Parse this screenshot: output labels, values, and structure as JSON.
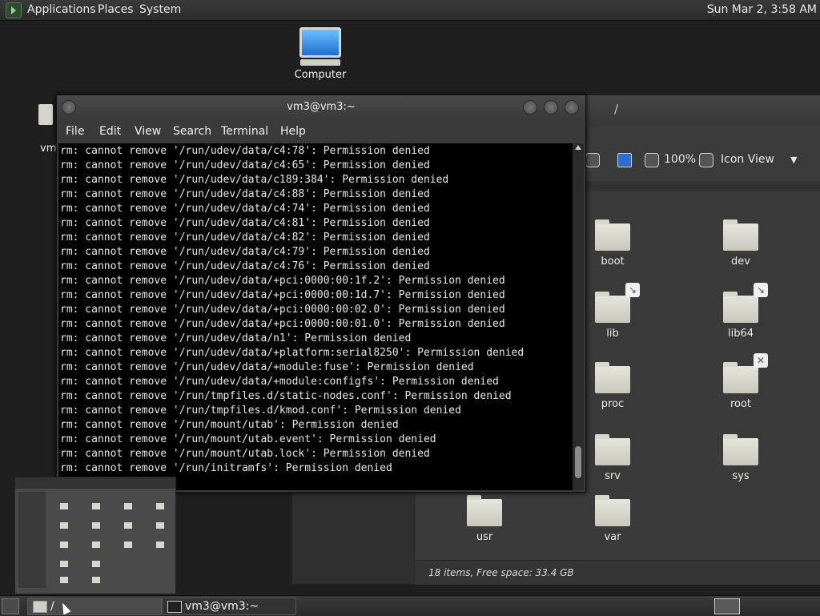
{
  "top_panel": {
    "menus": [
      "Applications",
      "Places",
      "System"
    ],
    "clock": "Sun Mar 2,  3:58 AM"
  },
  "desktop": {
    "icons": [
      {
        "label": "Computer",
        "icon": "computer-icon"
      },
      {
        "label": "vm",
        "icon": "home-folder-icon"
      }
    ]
  },
  "file_manager": {
    "title": "/",
    "zoom": "100%",
    "view_mode": "Icon View",
    "folders": [
      "boot",
      "dev",
      "lib",
      "lib64",
      "proc",
      "root",
      "srv",
      "sys",
      "usr",
      "var"
    ],
    "status": "18 items, Free space: 33.4 GB"
  },
  "terminal": {
    "title": "vm3@vm3:~",
    "menu": [
      "File",
      "Edit",
      "View",
      "Search",
      "Terminal",
      "Help"
    ],
    "lines": [
      "rm: cannot remove '/run/udev/data/c4:78': Permission denied",
      "rm: cannot remove '/run/udev/data/c4:65': Permission denied",
      "rm: cannot remove '/run/udev/data/c189:384': Permission denied",
      "rm: cannot remove '/run/udev/data/c4:88': Permission denied",
      "rm: cannot remove '/run/udev/data/c4:74': Permission denied",
      "rm: cannot remove '/run/udev/data/c4:81': Permission denied",
      "rm: cannot remove '/run/udev/data/c4:82': Permission denied",
      "rm: cannot remove '/run/udev/data/c4:79': Permission denied",
      "rm: cannot remove '/run/udev/data/c4:76': Permission denied",
      "rm: cannot remove '/run/udev/data/+pci:0000:00:1f.2': Permission denied",
      "rm: cannot remove '/run/udev/data/+pci:0000:00:1d.7': Permission denied",
      "rm: cannot remove '/run/udev/data/+pci:0000:00:02.0': Permission denied",
      "rm: cannot remove '/run/udev/data/+pci:0000:00:01.0': Permission denied",
      "rm: cannot remove '/run/udev/data/n1': Permission denied",
      "rm: cannot remove '/run/udev/data/+platform:serial8250': Permission denied",
      "rm: cannot remove '/run/udev/data/+module:fuse': Permission denied",
      "rm: cannot remove '/run/udev/data/+module:configfs': Permission denied",
      "rm: cannot remove '/run/tmpfiles.d/static-nodes.conf': Permission denied",
      "rm: cannot remove '/run/tmpfiles.d/kmod.conf': Permission denied",
      "rm: cannot remove '/run/mount/utab': Permission denied",
      "rm: cannot remove '/run/mount/utab.event': Permission denied",
      "rm: cannot remove '/run/mount/utab.lock': Permission denied",
      "rm: cannot remove '/run/initramfs': Permission denied"
    ]
  },
  "taskbar": {
    "tasks": [
      {
        "label": "/",
        "icon": "folder-icon"
      },
      {
        "label": "vm3@vm3:~",
        "icon": "terminal-icon"
      }
    ]
  }
}
